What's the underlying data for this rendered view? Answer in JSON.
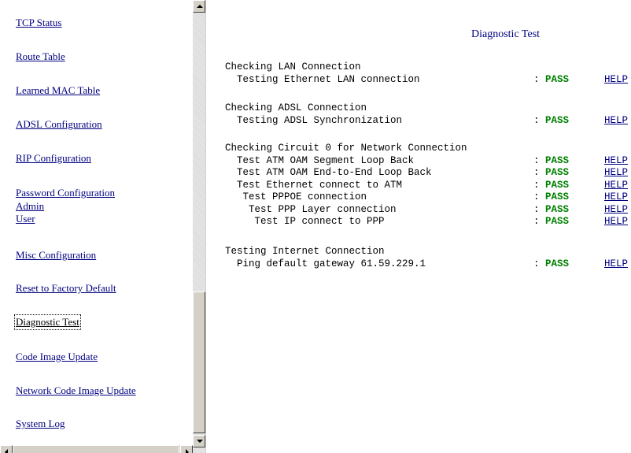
{
  "nav": {
    "tcp_status": "TCP Status",
    "route_table": "Route Table",
    "learned_mac": "Learned MAC Table",
    "adsl_config": "ADSL Configuration",
    "rip_config": "RIP Configuration",
    "password_config": "Password Configuration",
    "admin": "Admin",
    "user": "User",
    "misc_config": "Misc Configuration",
    "reset_factory": "Reset to Factory Default",
    "diagnostic_test": "Diagnostic Test",
    "code_image_update": "Code Image Update",
    "network_code_update": "Network Code Image Update",
    "system_log": "System Log"
  },
  "page": {
    "title": "Diagnostic Test"
  },
  "sections": {
    "lan": {
      "heading": "Checking LAN Connection",
      "tests": [
        {
          "label": "  Testing Ethernet LAN connection",
          "colon": ":",
          "result": "PASS",
          "help": "HELP"
        }
      ]
    },
    "adsl": {
      "heading": "Checking ADSL Connection",
      "tests": [
        {
          "label": "  Testing ADSL Synchronization",
          "colon": ":",
          "result": "PASS",
          "help": "HELP"
        }
      ]
    },
    "circuit": {
      "heading": "Checking Circuit 0 for Network Connection",
      "tests": [
        {
          "label": "  Test ATM OAM Segment Loop Back",
          "colon": ":",
          "result": "PASS",
          "help": "HELP"
        },
        {
          "label": "  Test ATM OAM End-to-End Loop Back",
          "colon": ":",
          "result": "PASS",
          "help": "HELP"
        },
        {
          "label": "  Test Ethernet connect to ATM",
          "colon": ":",
          "result": "PASS",
          "help": "HELP"
        },
        {
          "label": "   Test PPPOE connection",
          "colon": ":",
          "result": "PASS",
          "help": "HELP"
        },
        {
          "label": "    Test PPP Layer connection",
          "colon": ":",
          "result": "PASS",
          "help": "HELP"
        },
        {
          "label": "     Test IP connect to PPP",
          "colon": ":",
          "result": "PASS",
          "help": "HELP"
        }
      ]
    },
    "internet": {
      "heading": "Testing Internet Connection",
      "tests": [
        {
          "label": "  Ping default gateway 61.59.229.1",
          "colon": ":",
          "result": "PASS",
          "help": "HELP"
        }
      ]
    }
  },
  "colors": {
    "link": "#000080",
    "pass": "#008000"
  }
}
